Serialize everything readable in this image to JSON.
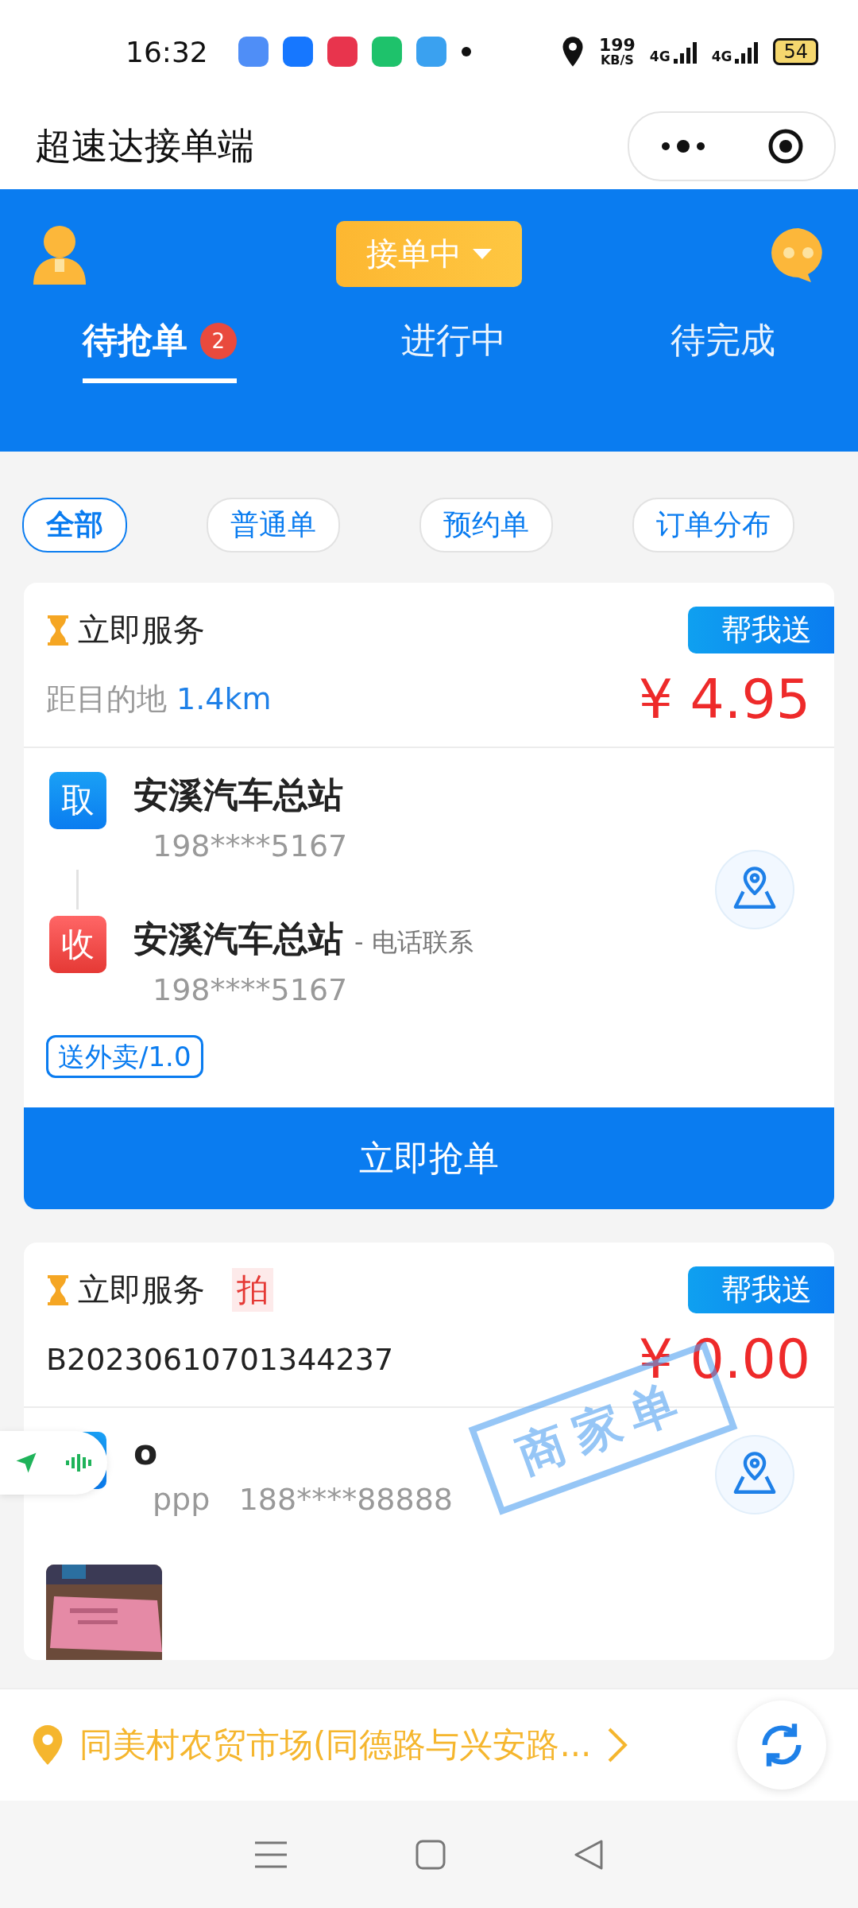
{
  "status_bar": {
    "time": "16:32",
    "speed_value": "199",
    "speed_unit": "KB/S",
    "networks": [
      "4G",
      "4G"
    ],
    "battery": "54"
  },
  "mini_program": {
    "title": "超速达接单端"
  },
  "header": {
    "status_button": "接单中",
    "tabs": [
      {
        "label": "待抢单",
        "badge": "2",
        "selected": true
      },
      {
        "label": "进行中",
        "selected": false
      },
      {
        "label": "待完成",
        "selected": false
      }
    ]
  },
  "filters": [
    {
      "label": "全部",
      "selected": true
    },
    {
      "label": "普通单",
      "selected": false
    },
    {
      "label": "预约单",
      "selected": false
    },
    {
      "label": "订单分布",
      "selected": false
    }
  ],
  "orders": [
    {
      "service": "立即服务",
      "type_tag": "帮我送",
      "subline": {
        "kind": "distance",
        "label": "距目的地",
        "value": "1.4km"
      },
      "price": "¥ 4.95",
      "stops": [
        {
          "kind": "pickup",
          "badge": "取",
          "name": "安溪汽车总站",
          "phone": "198****5167"
        },
        {
          "kind": "dropoff",
          "badge": "收",
          "name": "安溪汽车总站",
          "note": "- 电话联系",
          "phone": "198****5167"
        }
      ],
      "tags": [
        "送外卖/1.0"
      ],
      "action": "立即抢单"
    },
    {
      "service": "立即服务",
      "service_tag": "拍",
      "type_tag": "帮我送",
      "subline": {
        "kind": "order_no",
        "value": "B20230610701344237"
      },
      "price": "¥ 0.00",
      "stamp": "商家单",
      "stops": [
        {
          "kind": "pickup",
          "name": "o",
          "contact": "ppp",
          "phone": "188****88888"
        }
      ],
      "photos": [
        {
          "kind": "picture"
        }
      ]
    }
  ],
  "location_bar": {
    "address": "同美村农贸市场(同德路与兴安路..."
  }
}
